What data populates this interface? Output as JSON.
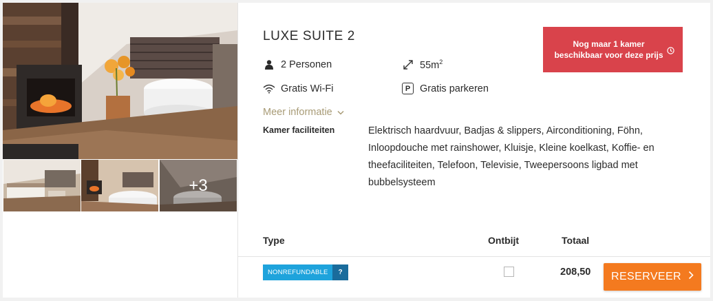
{
  "room": {
    "title": "LUXE SUITE 2",
    "persons": "2 Personen",
    "size_value": "55m",
    "size_sup": "2",
    "wifi": "Gratis Wi-Fi",
    "parking": "Gratis parkeren",
    "parking_icon_letter": "P",
    "more_info": "Meer informatie",
    "alert": "Nog maar 1 kamer beschikbaar voor deze prijs",
    "facilities_label": "Kamer faciliteiten",
    "facilities_text": "Elektrisch haardvuur, Badjas & slippers, Airconditioning, Föhn, Inloopdouche met rainshower, Kluisje, Kleine koelkast, Koffie- en theefaciliteiten, Telefoon, Televisie, Tweepersoons ligbad met bubbelsysteem"
  },
  "gallery": {
    "more_count": "+3"
  },
  "rate_table": {
    "headers": {
      "type": "Type",
      "ontbijt": "Ontbijt",
      "totaal": "Totaal"
    },
    "rows": [
      {
        "badge": "NONREFUNDABLE",
        "badge_info": "?",
        "breakfast_checked": false,
        "total": "208,50"
      }
    ]
  },
  "actions": {
    "reserve": "RESERVEER"
  },
  "colors": {
    "alert": "#d9434b",
    "badge": "#1ea3dc",
    "badge_info": "#1a6c9c",
    "reserve": "#f47a1f",
    "link": "#a89b76"
  },
  "icons": [
    "person-icon",
    "expand-arrows-icon",
    "wifi-icon",
    "parking-icon",
    "clock-icon",
    "chevron-down-icon",
    "chevron-right-icon"
  ]
}
